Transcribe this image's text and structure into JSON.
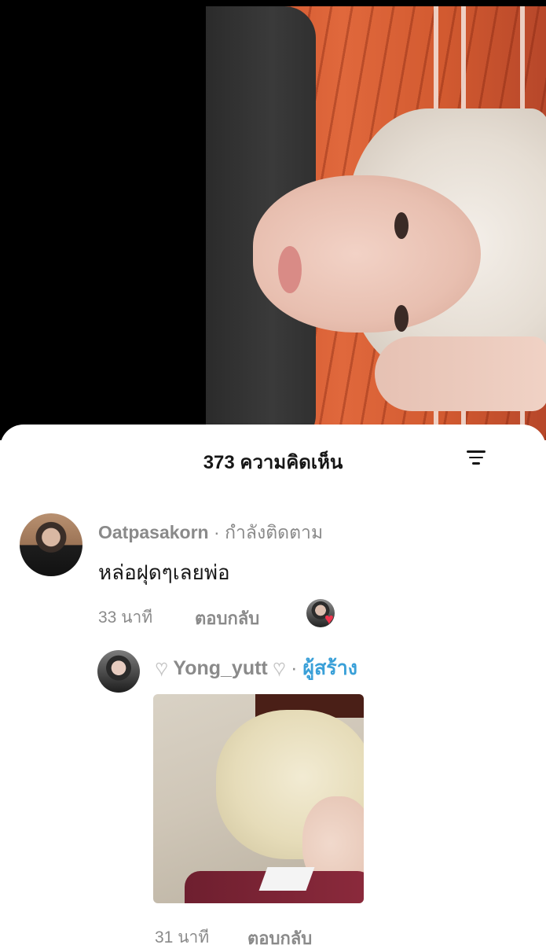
{
  "comments_header": {
    "count_label": "373 ความคิดเห็น"
  },
  "comments": [
    {
      "username": "Oatpasakorn",
      "separator": "·",
      "relation": "กำลังติดตาม",
      "text": "หล่อฝุดๆเลยพ่อ",
      "time": "33 นาที",
      "reply_label": "ตอบกลับ"
    }
  ],
  "reply": {
    "username": "Yong_yutt",
    "separator": "·",
    "badge": "ผู้สร้าง",
    "time": "31 นาที",
    "reply_label": "ตอบกลับ"
  },
  "colors": {
    "creator_badge": "#3aa0d8",
    "heart": "#f0344e"
  }
}
